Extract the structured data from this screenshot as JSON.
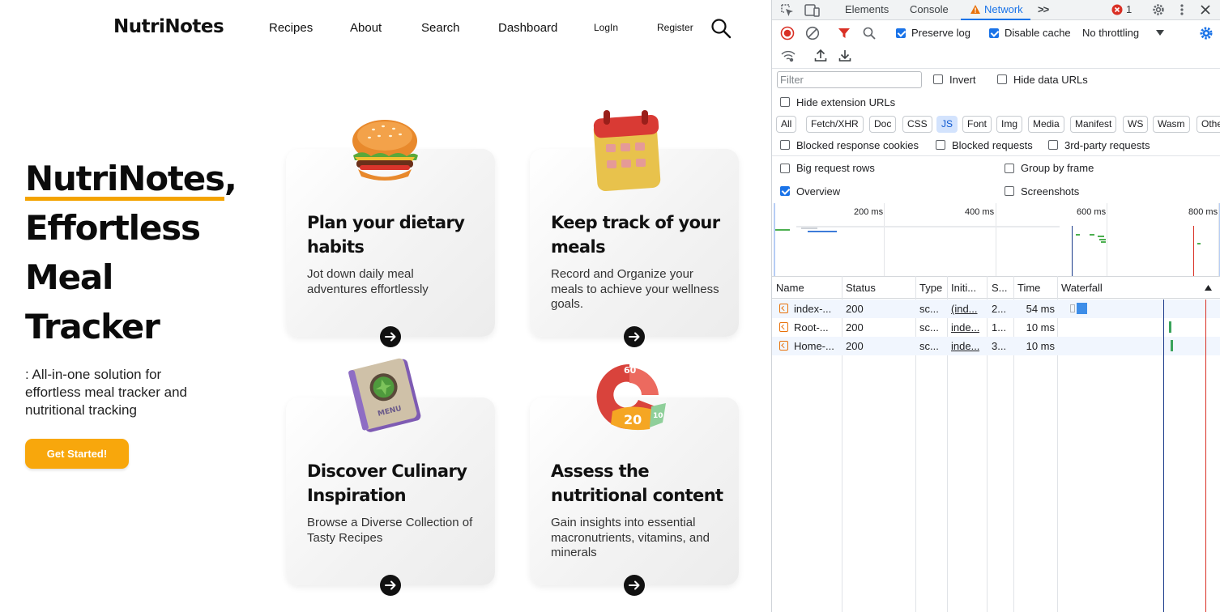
{
  "site": {
    "brand": "NutriNotes",
    "nav": [
      "Recipes",
      "About",
      "Search",
      "Dashboard",
      "LogIn",
      "Register"
    ],
    "hero": {
      "brand": "NutriNotes",
      "comma": ",",
      "line2": "Effortless",
      "line3": "Meal",
      "line4": "Tracker",
      "subtitle": ": All-in-one solution for effortless meal tracker and nutritional tracking",
      "cta": "Get Started!"
    },
    "cards": [
      {
        "title": "Plan your dietary habits",
        "text": "Jot down daily meal adventures effortlessly",
        "icon": "burger-icon"
      },
      {
        "title": "Keep track of your meals",
        "text": "Record and Organize your meals to achieve your wellness goals.",
        "icon": "calendar-icon"
      },
      {
        "title": "Discover Culinary Inspiration",
        "text": "Browse a Diverse Collection of Tasty Recipes",
        "icon": "menu-book-icon"
      },
      {
        "title": "Assess the nutritional content",
        "text": "Gain insights into essential macronutrients, vitamins, and minerals",
        "icon": "pie-chart-icon"
      }
    ],
    "illustration_text": {
      "menu": "MENU",
      "pie_60": "60",
      "pie_20": "20",
      "pie_10": "10"
    },
    "colors": {
      "accent": "#f8a70c",
      "underline": "#f4a300"
    }
  },
  "devtools": {
    "tabs": [
      "Elements",
      "Console",
      "Network"
    ],
    "active_tab": "Network",
    "more_tabs": ">>",
    "error_count": "1",
    "toolbar": {
      "preserve_log": "Preserve log",
      "disable_cache": "Disable cache",
      "throttling": "No throttling"
    },
    "filter": {
      "placeholder": "Filter",
      "invert": "Invert",
      "hide_data_urls": "Hide data URLs",
      "hide_extension_urls": "Hide extension URLs"
    },
    "chips": [
      "All",
      "Fetch/XHR",
      "Doc",
      "CSS",
      "JS",
      "Font",
      "Img",
      "Media",
      "Manifest",
      "WS",
      "Wasm",
      "Othe"
    ],
    "active_chip": "JS",
    "options": {
      "blocked_cookies": "Blocked response cookies",
      "blocked_requests": "Blocked requests",
      "third_party": "3rd-party requests",
      "big_rows": "Big request rows",
      "group_by_frame": "Group by frame",
      "overview": "Overview",
      "screenshots": "Screenshots"
    },
    "timeline_ticks": [
      "200 ms",
      "400 ms",
      "600 ms",
      "800 ms"
    ],
    "columns": [
      "Name",
      "Status",
      "Type",
      "Initi...",
      "S...",
      "Time",
      "Waterfall"
    ],
    "rows": [
      {
        "name": "index-...",
        "status": "200",
        "type": "sc...",
        "initiator": "(ind...",
        "size": "2...",
        "time": "54 ms"
      },
      {
        "name": "Root-...",
        "status": "200",
        "type": "sc...",
        "initiator": "inde...",
        "size": "1...",
        "time": "10 ms"
      },
      {
        "name": "Home-...",
        "status": "200",
        "type": "sc...",
        "initiator": "inde...",
        "size": "3...",
        "time": "10 ms"
      }
    ]
  }
}
